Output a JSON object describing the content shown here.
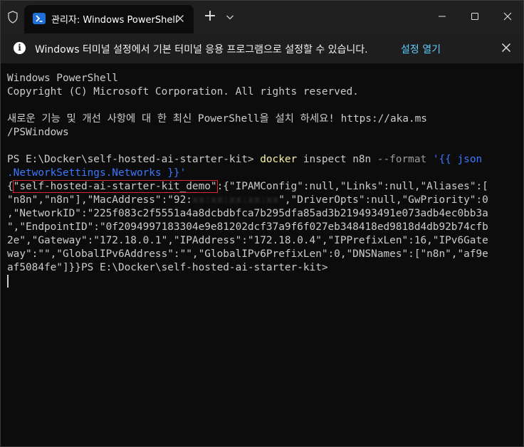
{
  "titlebar": {
    "tab_title": "관리자: Windows PowerShell",
    "new_tab_label": "+"
  },
  "infobar": {
    "message": "Windows 터미널 설정에서 기본 터미널 응용 프로그램으로 설정할 수 있습니다.",
    "link": "설정 열기"
  },
  "terminal": {
    "banner_1": "Windows PowerShell",
    "banner_2": "Copyright (C) Microsoft Corporation. All rights reserved.",
    "install_msg_1": "새로운 기능 및 개선 사항에 대 한 최신 PowerShell을 설치 하세요! https://aka.ms",
    "install_msg_2": "/PSWindows",
    "prompt": "PS E:\\Docker\\self-hosted-ai-starter-kit> ",
    "cmd": "docker",
    "cmd_args": " inspect n8n ",
    "cmd_flag": "--format",
    "cmd_str_1": " '{{ json",
    "cmd_str_2": ".NetworkSettings.Networks }}'",
    "out_1_open": "{",
    "out_1_hl": "\"self-hosted-ai-starter-kit_demo\"",
    "out_1_rest": ":{\"IPAMConfig\":null,\"Links\":null,\"Aliases\":[",
    "out_2_a": "\"n8n\",\"n8n\"],\"MacAddress\":\"92:",
    "out_2_redacted": "xx:xx:xx:xx:xx",
    "out_2_b": "\",\"DriverOpts\":null,\"GwPriority\":0",
    "out_3": ",\"NetworkID\":\"225f083c2f5551a4a8dcbdbfca7b295dfa85ad3b219493491e073adb4ec0bb3a",
    "out_4": "\",\"EndpointID\":\"0f2094997183304e9e81202dcf37a9f6f027eb348418ed9818d4db92b74cfb",
    "out_5": "2e\",\"Gateway\":\"172.18.0.1\",\"IPAddress\":\"172.18.0.4\",\"IPPrefixLen\":16,\"IPv6Gate",
    "out_6": "way\":\"\",\"GlobalIPv6Address\":\"\",\"GlobalIPv6PrefixLen\":0,\"DNSNames\":[\"n8n\",\"af9e",
    "out_7": "af5084fe\"]}}PS E:\\Docker\\self-hosted-ai-starter-kit>"
  },
  "colors": {
    "background": "#0c0c0c",
    "titlebar": "#202020",
    "infobar": "#1e1e1e",
    "link": "#60cdff",
    "highlight_box": "#e0242a",
    "command": "#f9f1a5",
    "string": "#3b78ff"
  }
}
